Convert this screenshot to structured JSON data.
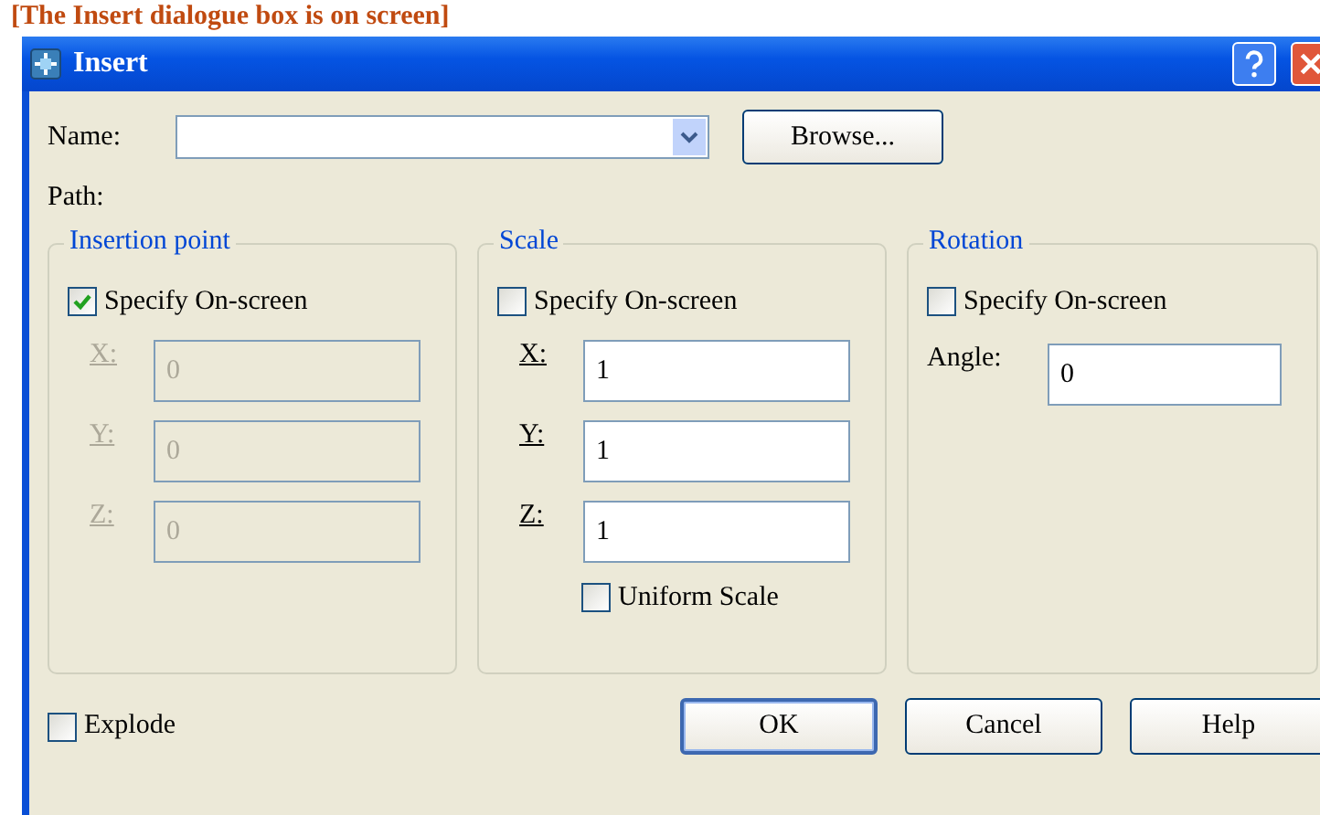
{
  "banner": "[The Insert dialogue box is on screen]",
  "window": {
    "title": "Insert"
  },
  "name_field": {
    "label": "Name:"
  },
  "browse_button": "Browse...",
  "path_label": "Path:",
  "groups": [
    {
      "title": "Insertion point",
      "specify": {
        "label": "Specify On-screen",
        "checked": true
      },
      "fields": [
        {
          "label": "X:",
          "value": "0",
          "disabled": true
        },
        {
          "label": "Y:",
          "value": "0",
          "disabled": true
        },
        {
          "label": "Z:",
          "value": "0",
          "disabled": true
        }
      ]
    },
    {
      "title": "Scale",
      "specify": {
        "label": "Specify On-screen",
        "checked": false
      },
      "fields": [
        {
          "label": "X:",
          "value": "1",
          "disabled": false
        },
        {
          "label": "Y:",
          "value": "1",
          "disabled": false
        },
        {
          "label": "Z:",
          "value": "1",
          "disabled": false
        }
      ],
      "extra": {
        "label": "Uniform Scale",
        "checked": false
      }
    },
    {
      "title": "Rotation",
      "specify": {
        "label": "Specify On-screen",
        "checked": false
      },
      "fields": [
        {
          "label": "Angle:",
          "value": "0",
          "disabled": false
        }
      ]
    }
  ],
  "explode": {
    "label": "Explode",
    "checked": false
  },
  "buttons": [
    "OK",
    "Cancel",
    "Help"
  ]
}
